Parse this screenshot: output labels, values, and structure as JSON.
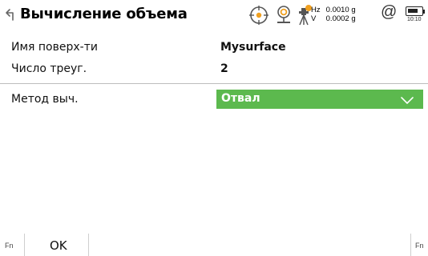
{
  "header": {
    "title": "Вычисление объема",
    "back_icon": "back-arrow-icon",
    "icons": [
      "prism-target-icon",
      "reflector-icon",
      "instrument-status-icon"
    ],
    "angles": {
      "hz_label": "Hz",
      "hz_value": "0.0010 g",
      "v_label": "V",
      "v_value": "0.0002 g"
    },
    "at_symbol": "@",
    "battery_time": "10:10"
  },
  "form": {
    "surface_label": "Имя поверх-ти",
    "surface_value": "Mysurface",
    "triangles_label": "Число треуг.",
    "triangles_value": "2",
    "method_label": "Метод выч.",
    "method_value": "Отвал"
  },
  "footer": {
    "fn_left": "Fn",
    "ok_label": "OK",
    "fn_right": "Fn"
  },
  "colors": {
    "accent_green": "#5cb94e",
    "status_orange": "#f0a020"
  }
}
